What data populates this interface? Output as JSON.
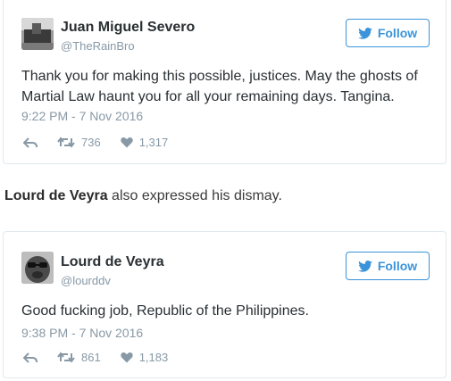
{
  "tweets": [
    {
      "author_name": "Juan Miguel Severo",
      "handle": "@TheRainBro",
      "follow_label": "Follow",
      "text": "Thank you for making this possible, justices. May the ghosts of Martial Law haunt you for all your remaining days. Tangina.",
      "timestamp": "9:22 PM - 7 Nov 2016",
      "retweets": "736",
      "likes": "1,317"
    },
    {
      "author_name": "Lourd de Veyra",
      "handle": "@lourddv",
      "follow_label": "Follow",
      "text": "Good fucking job, Republic of the Philippines.",
      "timestamp": "9:38 PM - 7 Nov 2016",
      "retweets": "861",
      "likes": "1,183"
    }
  ],
  "caption": {
    "name": "Lourd de Veyra",
    "rest": " also expressed his dismay."
  },
  "colors": {
    "accent": "#3b94d9",
    "muted": "#8899a6",
    "text": "#292f33",
    "border": "#e1e8ed"
  }
}
